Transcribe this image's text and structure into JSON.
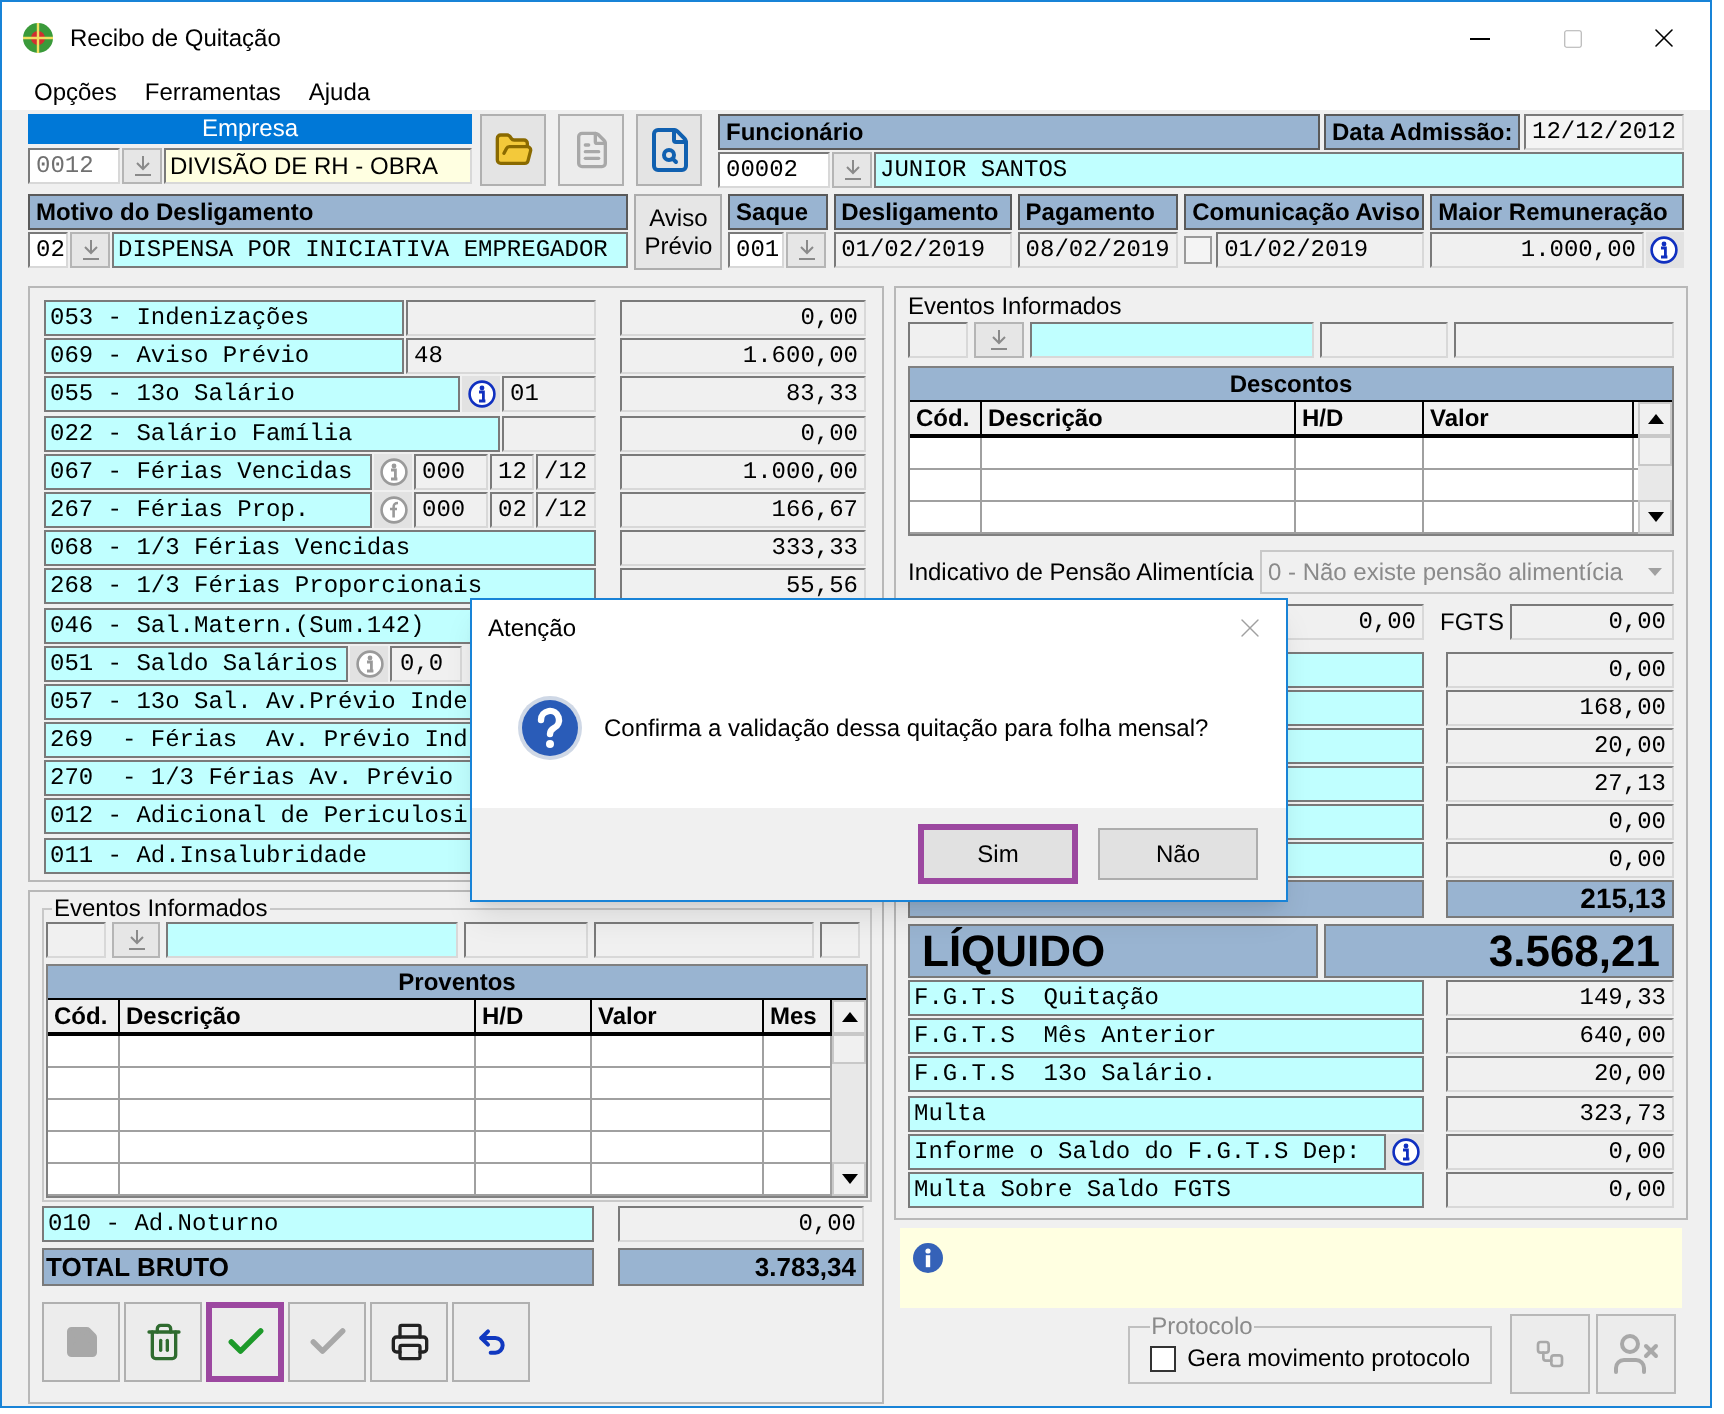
{
  "window": {
    "title": "Recibo de Quitação"
  },
  "menu": [
    "Opções",
    "Ferramentas",
    "Ajuda"
  ],
  "empresa": {
    "header": "Empresa",
    "code": "0012",
    "name": "DIVISÃO DE RH - OBRA"
  },
  "top_tools": [
    {
      "kind": "open-folder",
      "disabled": false
    },
    {
      "kind": "document",
      "disabled": true
    },
    {
      "kind": "search-document",
      "disabled": false
    }
  ],
  "funcionario": {
    "header": "Funcionário",
    "code": "00002",
    "name": "JUNIOR SANTOS",
    "admission_label": "Data Admissão:",
    "admission_date": "12/12/2012"
  },
  "motivo": {
    "header": "Motivo do Desligamento",
    "code": "02",
    "description": "DISPENSA POR INICIATIVA EMPREGADOR"
  },
  "aviso_previo_button": "Aviso Prévio",
  "saque": {
    "header": "Saque",
    "code": "001"
  },
  "desligamento": {
    "header": "Desligamento",
    "date": "01/02/2019"
  },
  "pagamento": {
    "header": "Pagamento",
    "date": "08/02/2019"
  },
  "comunicacao_aviso": {
    "header": "Comunicação Aviso",
    "checked": false,
    "date": "01/02/2019"
  },
  "maior_remuneracao": {
    "header": "Maior Remuneração",
    "value": "1.000,00"
  },
  "earnings": [
    {
      "kind": "blank-wide",
      "label": "053 - Indenizações",
      "value": "0,00"
    },
    {
      "kind": "wide",
      "label": "069 - Aviso Prévio",
      "field": "48",
      "value": "1.600,00"
    },
    {
      "kind": "info-narrow",
      "label": "055 - 13o Salário",
      "icon": {
        "kind": "info",
        "disabled": false
      },
      "field": "01",
      "value": "83,33"
    },
    {
      "kind": "blank-narrow",
      "label": "022 - Salário Família",
      "value": "0,00"
    },
    {
      "kind": "period",
      "label": "067 - Férias Vencidas",
      "icon": {
        "kind": "info",
        "disabled": true
      },
      "fields": [
        "000",
        "12",
        "/12"
      ],
      "value": "1.000,00"
    },
    {
      "kind": "period",
      "label": "267 - Férias Prop.",
      "icon": {
        "kind": "formula",
        "disabled": true
      },
      "fields": [
        "000",
        "02",
        "/12"
      ],
      "value": "166,67"
    },
    {
      "kind": "full",
      "label": "068 - 1/3 Férias Vencidas",
      "value": "333,33"
    },
    {
      "kind": "full",
      "label": "268 - 1/3 Férias Proporcionais",
      "value": "55,56"
    },
    {
      "kind": "full",
      "label": "046 - Sal.Matern.(Sum.142)"
    },
    {
      "kind": "saldo",
      "label": "051 - Saldo Salários",
      "icon": {
        "kind": "info",
        "disabled": true
      },
      "field": "0,0"
    },
    {
      "kind": "full",
      "label": "057 - 13o Sal. Av.Prévio Inde"
    },
    {
      "kind": "full",
      "label": "269  - Férias  Av. Prévio Ind"
    },
    {
      "kind": "full",
      "label": "270  - 1/3 Férias Av. Prévio"
    },
    {
      "kind": "full",
      "label": "012 - Adicional de Periculosi"
    },
    {
      "kind": "full",
      "label": "011 - Ad.Insalubridade"
    }
  ],
  "eventos_left": {
    "title": "Eventos Informados",
    "table_title": "Proventos",
    "columns": [
      "Cód.",
      "Descrição",
      "H/D",
      "Valor",
      "Mes"
    ]
  },
  "adicional_noturno": {
    "label": "010 - Ad.Noturno",
    "value": "0,00"
  },
  "total_bruto": {
    "label": "TOTAL BRUTO",
    "value": "3.783,34"
  },
  "toolbar": [
    {
      "kind": "save",
      "disabled": true,
      "highlighted": false
    },
    {
      "kind": "recycle",
      "disabled": false,
      "highlighted": false
    },
    {
      "kind": "confirm",
      "disabled": false,
      "highlighted": true
    },
    {
      "kind": "confirm",
      "disabled": true,
      "highlighted": false
    },
    {
      "kind": "print",
      "disabled": false,
      "highlighted": false
    },
    {
      "kind": "undo",
      "disabled": false,
      "highlighted": false
    }
  ],
  "eventos_right": {
    "title": "Eventos Informados",
    "table_title": "Descontos",
    "columns": [
      "Cód.",
      "Descrição",
      "H/D",
      "Valor"
    ]
  },
  "pensao": {
    "label": "Indicativo de Pensão Alimentícia",
    "value": "0 - Não existe pensão alimentícia",
    "disabled": true
  },
  "first_row": {
    "value": "0,00",
    "fgts_label": "FGTS",
    "fgts_value": "0,00"
  },
  "deduction_values": [
    "0,00",
    "168,00",
    "20,00",
    "27,13",
    "0,00",
    "0,00"
  ],
  "total_descontos": "215,13",
  "liquido": {
    "label": "LÍQUIDO",
    "value": "3.568,21"
  },
  "fgts_rows": [
    {
      "label": "F.G.T.S  Quitação",
      "value": "149,33",
      "info": false
    },
    {
      "label": "F.G.T.S  Mês Anterior",
      "value": "640,00",
      "info": false
    },
    {
      "label": "F.G.T.S  13o Salário.",
      "value": "20,00",
      "info": false
    },
    {
      "label": "Multa",
      "value": "323,73",
      "info": false
    },
    {
      "label": "Informe o Saldo do F.G.T.S Dep:",
      "value": "0,00",
      "info": true
    },
    {
      "label": "Multa Sobre Saldo FGTS",
      "value": "0,00",
      "info": false
    }
  ],
  "protocolo": {
    "title": "Protocolo",
    "checkbox_label": "Gera movimento protocolo",
    "checked": false
  },
  "protocolo_tools": [
    {
      "kind": "network",
      "disabled": true
    },
    {
      "kind": "user-remove",
      "disabled": true
    }
  ],
  "dialog": {
    "title": "Atenção",
    "message": "Confirma a validação dessa quitação para folha mensal?",
    "buttons": [
      {
        "label": "Sim",
        "highlighted": true
      },
      {
        "label": "Não",
        "highlighted": false
      }
    ]
  }
}
